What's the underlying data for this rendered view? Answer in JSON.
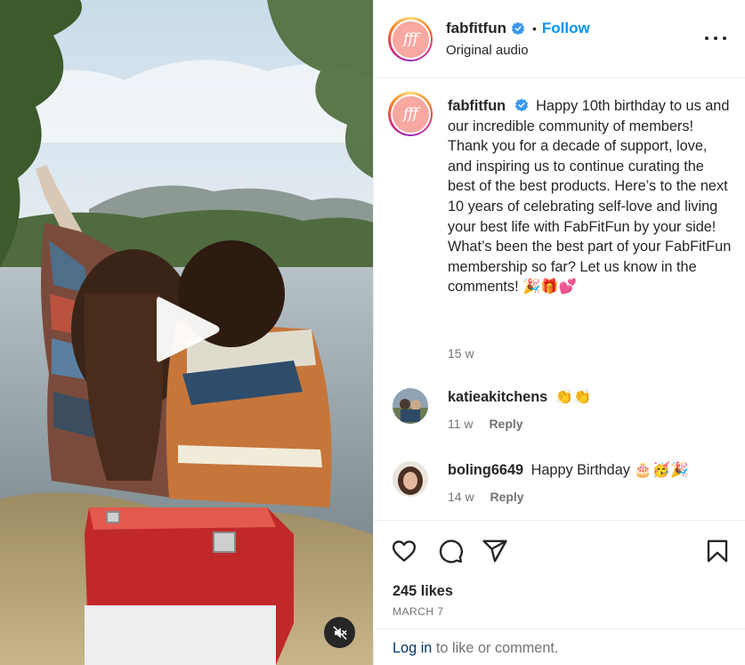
{
  "post": {
    "username": "fabfitfun",
    "avatar_initials": "fff",
    "follow_label": "Follow",
    "dot": "•",
    "audio_label": "Original audio",
    "caption_text": "Happy 10th birthday to us and our incredible community of members! Thank you for a decade of support, love, and inspiring us to continue curating the best of the best products. Here’s to the next 10 years of celebrating self-love and living your best life with FabFitFun by your side! What’s been the best part of your FabFitFun membership so far? Let us know in the comments! 🎉🎁💕",
    "caption_time": "15 w",
    "likes": "245 likes",
    "date": "MARCH 7"
  },
  "comments": [
    {
      "username": "katieakitchens",
      "text": "👏👏",
      "time": "11 w",
      "reply_label": "Reply"
    },
    {
      "username": "boling6649",
      "text": "Happy Birthday 🎂🥳🎉",
      "time": "14 w",
      "reply_label": "Reply"
    }
  ],
  "login": {
    "link_label": "Log in",
    "rest_label": "to like or comment."
  },
  "icons": {
    "play": "play-icon",
    "mute": "muted-speaker-icon",
    "verified": "verified-badge-icon",
    "more": "more-options-icon",
    "like": "heart-icon",
    "comment": "comment-bubble-icon",
    "share": "paper-plane-icon",
    "save": "bookmark-icon"
  },
  "colors": {
    "follow": "#0095f6",
    "verified": "#3897f0",
    "text": "#262626",
    "secondary": "#737373",
    "login_link": "#00376b",
    "brand_pink": "#f6a8a1"
  }
}
